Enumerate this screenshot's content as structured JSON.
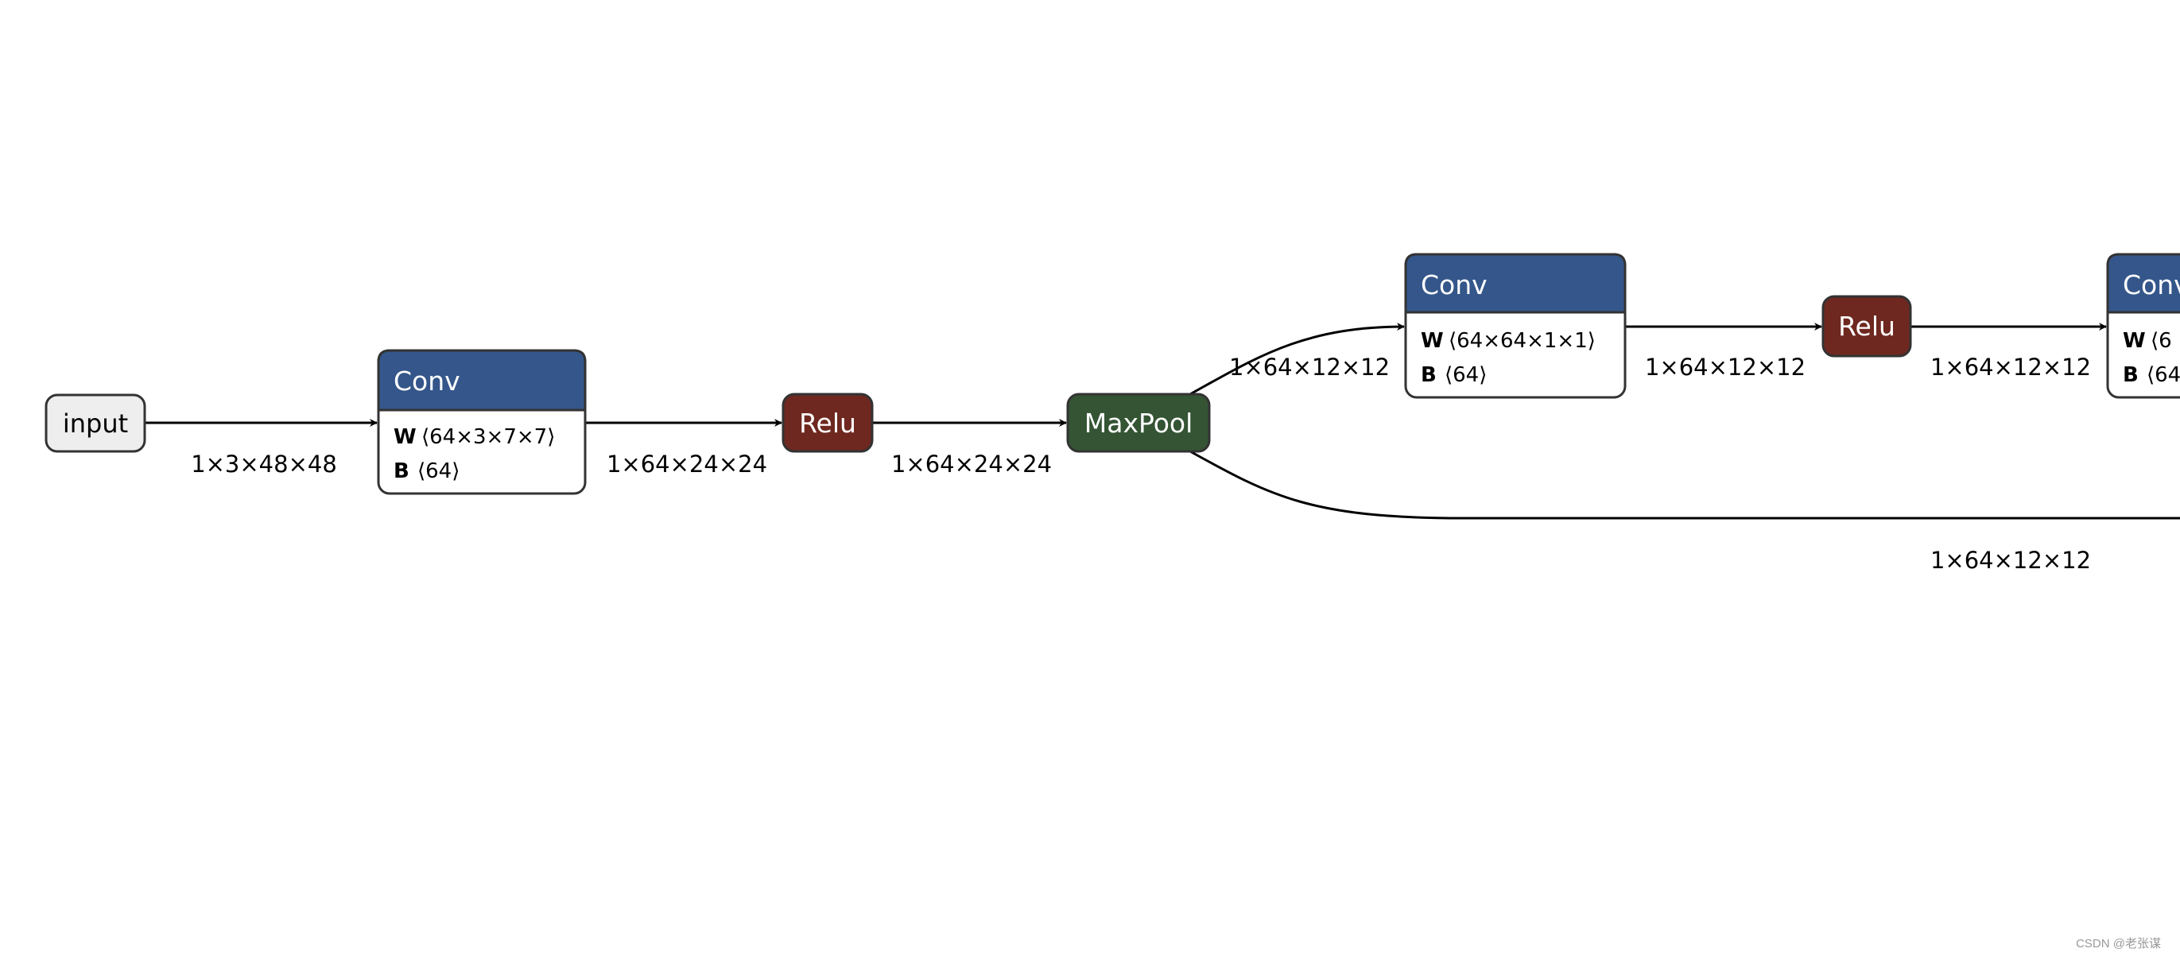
{
  "colors": {
    "conv": "#34568a",
    "relu": "#6e2820",
    "maxpool": "#345434",
    "input": "#eeeeee"
  },
  "nodes": {
    "input": {
      "label": "input"
    },
    "conv1": {
      "title": "Conv",
      "w_key": "W",
      "w_val": "⟨64×3×7×7⟩",
      "b_key": "B",
      "b_val": "⟨64⟩"
    },
    "relu1": {
      "title": "Relu"
    },
    "maxpool": {
      "title": "MaxPool"
    },
    "conv2": {
      "title": "Conv",
      "w_key": "W",
      "w_val": "⟨64×64×1×1⟩",
      "b_key": "B",
      "b_val": "⟨64⟩"
    },
    "relu2": {
      "title": "Relu"
    },
    "conv3": {
      "title": "Conv",
      "w_key": "W",
      "w_val": "⟨6",
      "b_key": "B",
      "b_val": "⟨64"
    }
  },
  "edges": {
    "input_conv1": "1×3×48×48",
    "conv1_relu1": "1×64×24×24",
    "relu1_maxpool": "1×64×24×24",
    "maxpool_conv2": "1×64×12×12",
    "conv2_relu2": "1×64×12×12",
    "relu2_conv3": "1×64×12×12",
    "maxpool_skip": "1×64×12×12"
  },
  "watermark": "CSDN @老张谋"
}
